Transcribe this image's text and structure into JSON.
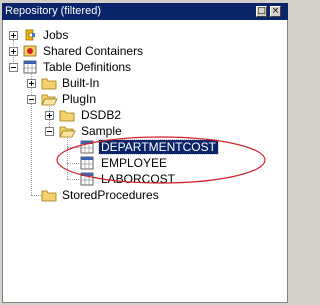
{
  "panel": {
    "title": "Repository (filtered)",
    "buttons": {
      "restore": "□",
      "close": "×"
    }
  },
  "tree": {
    "jobs": "Jobs",
    "shared_containers": "Shared Containers",
    "table_definitions": "Table Definitions",
    "built_in": "Built-In",
    "plugin": "PlugIn",
    "dsdb2": "DSDB2",
    "sample": "Sample",
    "departmentcost": "DEPARTMENTCOST",
    "employee": "EMPLOYEE",
    "laborcost": "LABORCOST",
    "stored_procedures": "StoredProcedures"
  },
  "colors": {
    "title_bg": "#0a246a",
    "selection_bg": "#0a246a",
    "annotation": "#d0202a",
    "folder": "#f5d26b"
  }
}
